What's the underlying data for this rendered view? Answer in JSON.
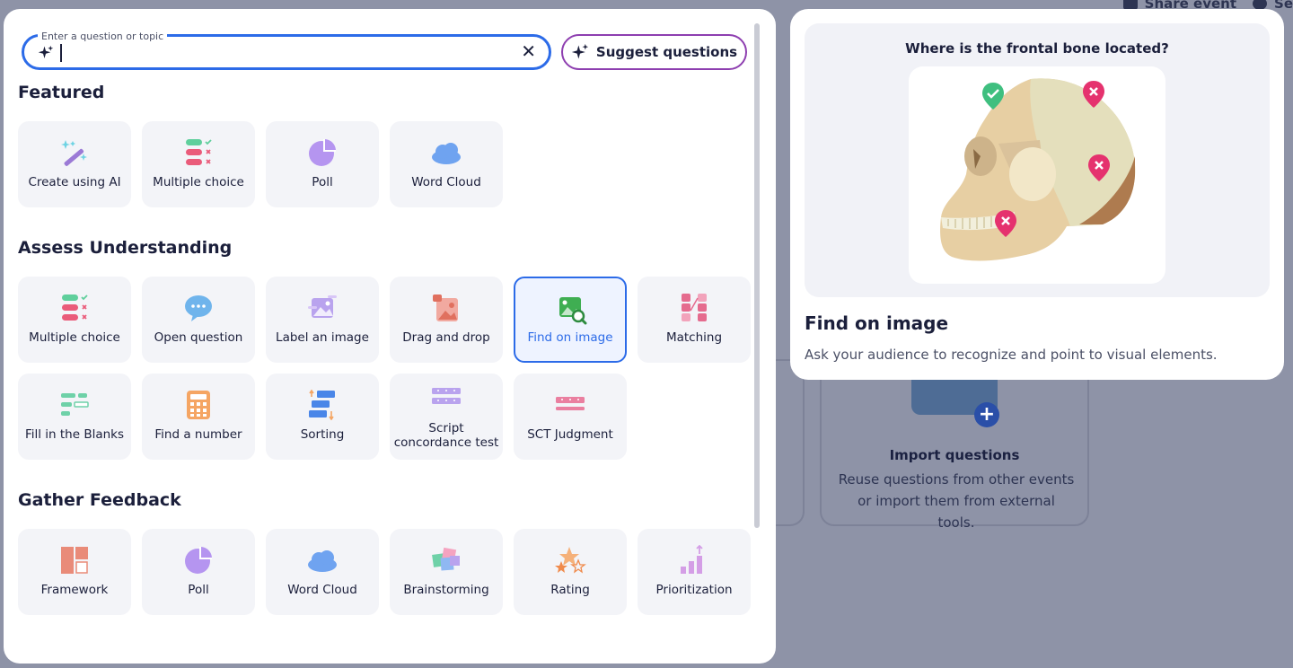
{
  "search": {
    "label": "Enter a question or topic",
    "value": "",
    "placeholder": ""
  },
  "suggest_label": "Suggest questions",
  "sections": {
    "featured": "Featured",
    "assess": "Assess Understanding",
    "feedback": "Gather Feedback"
  },
  "featured": [
    {
      "label": "Create using AI",
      "icon": "magic-wand-icon"
    },
    {
      "label": "Multiple choice",
      "icon": "multiple-choice-icon"
    },
    {
      "label": "Poll",
      "icon": "pie-chart-icon"
    },
    {
      "label": "Word Cloud",
      "icon": "cloud-icon"
    }
  ],
  "assess": [
    {
      "label": "Multiple choice",
      "icon": "multiple-choice-icon"
    },
    {
      "label": "Open question",
      "icon": "speech-bubble-icon"
    },
    {
      "label": "Label an image",
      "icon": "label-image-icon"
    },
    {
      "label": "Drag and drop",
      "icon": "drag-drop-icon"
    },
    {
      "label": "Find on image",
      "icon": "find-on-image-icon",
      "selected": true
    },
    {
      "label": "Matching",
      "icon": "matching-icon"
    },
    {
      "label": "Fill in the Blanks",
      "icon": "fill-blanks-icon"
    },
    {
      "label": "Find a number",
      "icon": "calculator-icon"
    },
    {
      "label": "Sorting",
      "icon": "sorting-icon"
    },
    {
      "label": "Script concordance test",
      "icon": "script-concordance-icon"
    },
    {
      "label": "SCT Judgment",
      "icon": "sct-judgment-icon"
    }
  ],
  "feedback": [
    {
      "label": "Framework",
      "icon": "framework-icon"
    },
    {
      "label": "Poll",
      "icon": "pie-chart-icon"
    },
    {
      "label": "Word Cloud",
      "icon": "cloud-icon"
    },
    {
      "label": "Brainstorming",
      "icon": "sticky-notes-icon"
    },
    {
      "label": "Rating",
      "icon": "stars-icon"
    },
    {
      "label": "Prioritization",
      "icon": "bar-chart-arrow-icon"
    }
  ],
  "preview": {
    "question": "Where is the frontal bone located?",
    "title": "Find on image",
    "description": "Ask your audience to recognize and point to visual elements."
  },
  "background": {
    "share_event": "Share event",
    "settings": "Se",
    "import_title": "Import questions",
    "import_desc": "Reuse questions from other events or import them from external tools."
  },
  "colors": {
    "accent": "#2c6be8",
    "suggest_border": "#8e3fb0",
    "tile_bg": "#f3f4f8"
  }
}
